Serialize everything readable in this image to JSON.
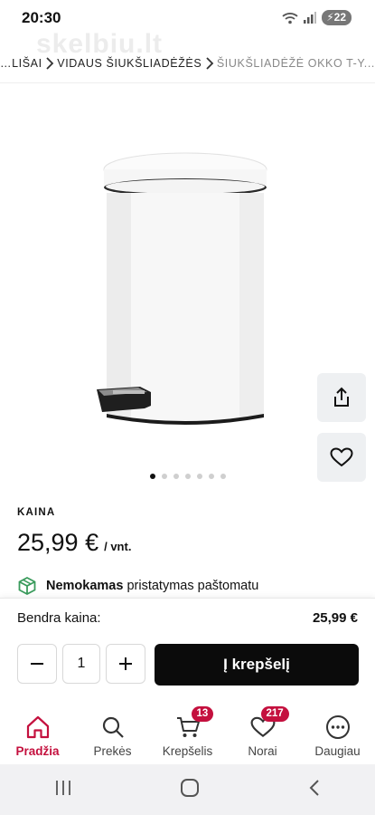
{
  "status_bar": {
    "time": "20:30",
    "battery": "22",
    "watermark": "skelbiu.lt"
  },
  "breadcrumb": {
    "items": [
      "…LIŠAI",
      "VIDAUS ŠIUKŠLIADĖŽĖS",
      "ŠIUKŠLIADĖŽĖ OKKO T-Y..."
    ]
  },
  "gallery": {
    "image_count": 7,
    "active_index": 0
  },
  "price": {
    "label": "KAINA",
    "value": "25,99 €",
    "unit": "/ vnt."
  },
  "delivery": {
    "bold": "Nemokamas",
    "rest": "pristatymas paštomatu"
  },
  "total": {
    "label": "Bendra kaina:",
    "value": "25,99 €"
  },
  "quantity": {
    "value": "1"
  },
  "cart_button": {
    "label": "Į krepšelį"
  },
  "bottom_nav": {
    "items": [
      {
        "label": "Pradžia",
        "icon": "home-icon",
        "active": true
      },
      {
        "label": "Prekės",
        "icon": "search-icon"
      },
      {
        "label": "Krepšelis",
        "icon": "cart-icon",
        "badge": "13"
      },
      {
        "label": "Norai",
        "icon": "heart-icon",
        "badge": "217"
      },
      {
        "label": "Daugiau",
        "icon": "more-icon"
      }
    ]
  },
  "colors": {
    "accent": "#c4103e",
    "button_dark": "#0b0b0b",
    "side_button_bg": "#eef0f2"
  }
}
